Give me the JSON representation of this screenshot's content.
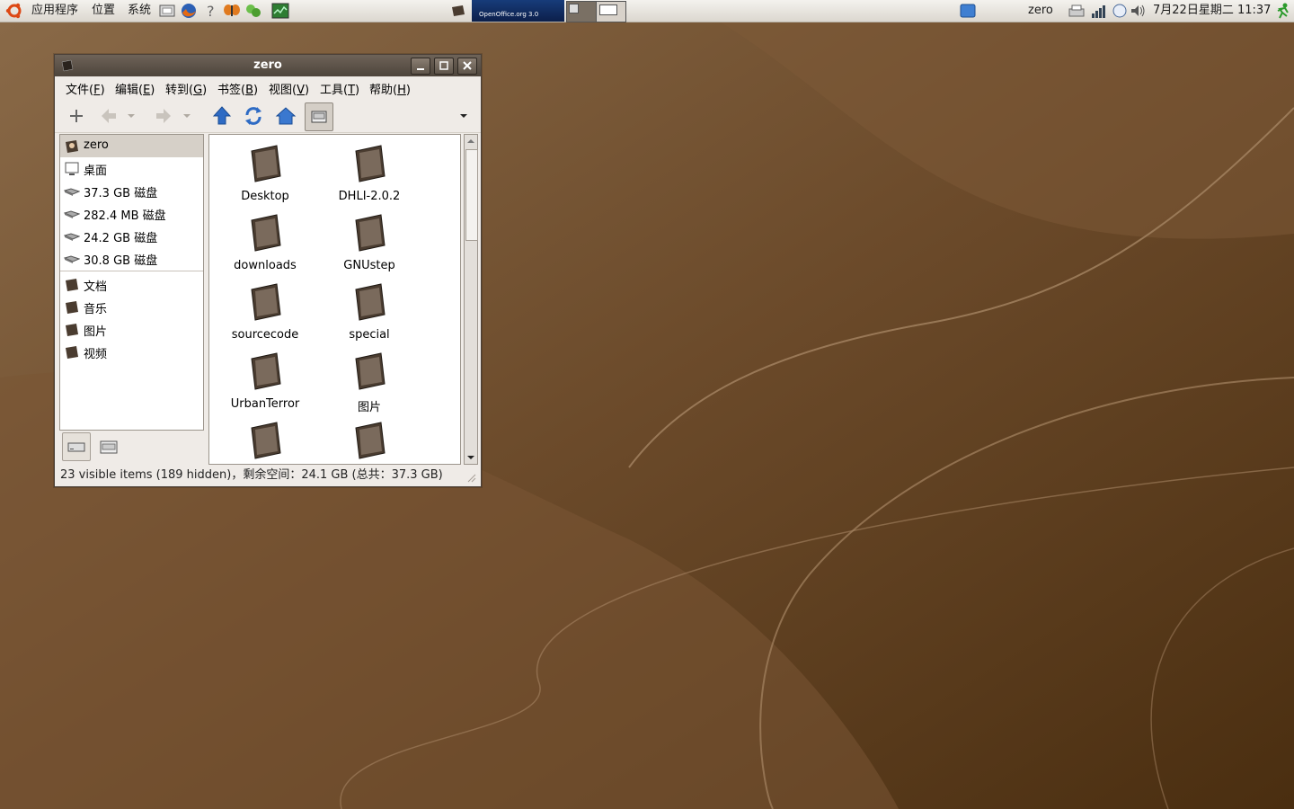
{
  "top_panel": {
    "menus": [
      "应用程序",
      "位置",
      "系统"
    ],
    "user": "zero",
    "clock": "7月22日星期二 11:37",
    "openoffice_banner": "OpenOffice.org 3.0"
  },
  "window": {
    "title": "zero",
    "menu": [
      {
        "label": "文件(",
        "key": "F",
        "tail": ")"
      },
      {
        "label": "编辑(",
        "key": "E",
        "tail": ")"
      },
      {
        "label": "转到(",
        "key": "G",
        "tail": ")"
      },
      {
        "label": "书签(",
        "key": "B",
        "tail": ")"
      },
      {
        "label": "视图(",
        "key": "V",
        "tail": ")"
      },
      {
        "label": "工具(",
        "key": "T",
        "tail": ")"
      },
      {
        "label": "帮助(",
        "key": "H",
        "tail": ")"
      }
    ],
    "sidebar": {
      "devices": [
        "zero",
        "桌面",
        "37.3 GB 磁盘",
        "282.4 MB 磁盘",
        "24.2 GB 磁盘",
        "30.8 GB 磁盘"
      ],
      "places": [
        "文档",
        "音乐",
        "图片",
        "视频"
      ]
    },
    "files": [
      "Desktop",
      "DHLI-2.0.2",
      "downloads",
      "GNUstep",
      "sourcecode",
      "special",
      "UrbanTerror",
      "图片",
      "",
      ""
    ],
    "status": "23 visible items (189 hidden)，剩余空间：24.1 GB (总共：37.3 GB)"
  },
  "colors": {
    "wallpaper": "#6b4a2b",
    "titlebar": "#5a5046",
    "selection": "#d6d0c8"
  }
}
